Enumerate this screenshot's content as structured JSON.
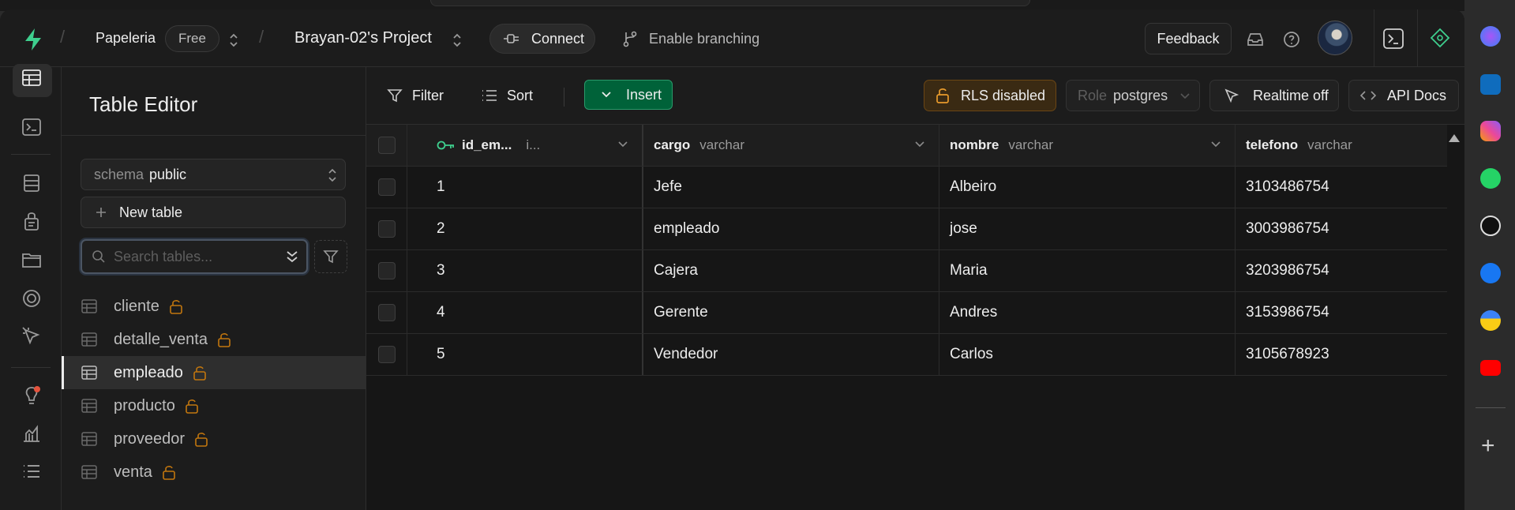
{
  "header": {
    "org_name": "Papeleria",
    "plan_badge": "Free",
    "project_name": "Brayan-02's Project",
    "connect_label": "Connect",
    "branching_label": "Enable branching",
    "feedback_label": "Feedback"
  },
  "sidebar": {
    "title": "Table Editor",
    "schema_label": "schema",
    "schema_value": "public",
    "new_table_label": "New table",
    "search_placeholder": "Search tables...",
    "tables": [
      {
        "name": "cliente",
        "locked": true,
        "active": false
      },
      {
        "name": "detalle_venta",
        "locked": true,
        "active": false
      },
      {
        "name": "empleado",
        "locked": true,
        "active": true
      },
      {
        "name": "producto",
        "locked": true,
        "active": false
      },
      {
        "name": "proveedor",
        "locked": true,
        "active": false
      },
      {
        "name": "venta",
        "locked": true,
        "active": false
      }
    ]
  },
  "toolbar": {
    "filter_label": "Filter",
    "sort_label": "Sort",
    "insert_label": "Insert",
    "rls_label": "RLS disabled",
    "role_label": "Role",
    "role_value": "postgres",
    "realtime_label": "Realtime off",
    "api_docs_label": "API Docs"
  },
  "grid": {
    "columns": [
      {
        "name": "id_em...",
        "type": "i...",
        "primary_key": true
      },
      {
        "name": "cargo",
        "type": "varchar"
      },
      {
        "name": "nombre",
        "type": "varchar"
      },
      {
        "name": "telefono",
        "type": "varchar"
      }
    ],
    "rows": [
      {
        "id": "1",
        "cargo": "Jefe",
        "nombre": "Albeiro",
        "telefono": "3103486754"
      },
      {
        "id": "2",
        "cargo": "empleado",
        "nombre": "jose",
        "telefono": "3003986754"
      },
      {
        "id": "3",
        "cargo": "Cajera",
        "nombre": "Maria",
        "telefono": "3203986754"
      },
      {
        "id": "4",
        "cargo": "Gerente",
        "nombre": "Andres",
        "telefono": "3153986754"
      },
      {
        "id": "5",
        "cargo": "Vendedor",
        "nombre": "Carlos",
        "telefono": "3105678923"
      }
    ]
  },
  "colors": {
    "brand_green": "#3ecf8e",
    "insert_bg": "#006239",
    "rls_warning": "#c2760e",
    "background": "#1c1c1c"
  },
  "browser_sidebar_icons": [
    "messenger-icon",
    "outlook-icon",
    "instagram-icon",
    "whatsapp-icon",
    "chatgpt-icon",
    "facebook-icon",
    "medal-icon",
    "youtube-icon",
    "plus-icon"
  ]
}
